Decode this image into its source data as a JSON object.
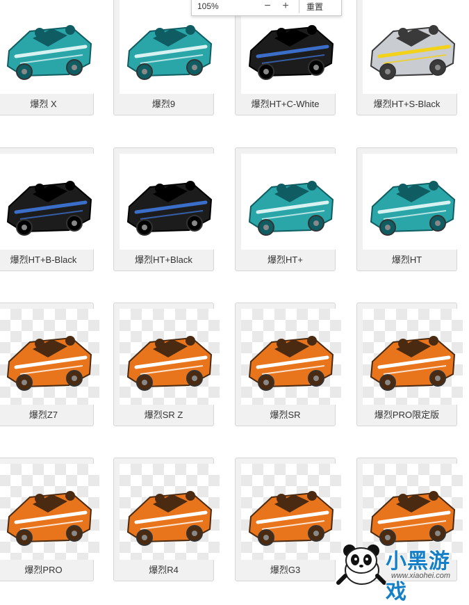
{
  "zoom": {
    "percent": "105%",
    "minus": "−",
    "plus": "+",
    "reset": "重置"
  },
  "cards": [
    {
      "label": "爆烈 X",
      "style": "teal",
      "bg": "plain"
    },
    {
      "label": "爆烈9",
      "style": "teal",
      "bg": "plain"
    },
    {
      "label": "爆烈HT+C-White",
      "style": "black",
      "bg": "plain"
    },
    {
      "label": "爆烈HT+S-Black",
      "style": "silver",
      "bg": "plain"
    },
    {
      "label": "爆烈HT+B-Black",
      "style": "black",
      "bg": "plain"
    },
    {
      "label": "爆烈HT+Black",
      "style": "black",
      "bg": "plain"
    },
    {
      "label": "爆烈HT+",
      "style": "teal",
      "bg": "plain"
    },
    {
      "label": "爆烈HT",
      "style": "teal",
      "bg": "plain"
    },
    {
      "label": "爆烈Z7",
      "style": "orange",
      "bg": "checker"
    },
    {
      "label": "爆烈SR Z",
      "style": "orange",
      "bg": "checker"
    },
    {
      "label": "爆烈SR",
      "style": "orange",
      "bg": "checker"
    },
    {
      "label": "爆烈PRO限定版",
      "style": "orange",
      "bg": "checker"
    },
    {
      "label": "爆烈PRO",
      "style": "orange",
      "bg": "checker"
    },
    {
      "label": "爆烈R4",
      "style": "orange",
      "bg": "checker"
    },
    {
      "label": "爆烈G3",
      "style": "orange",
      "bg": "checker"
    },
    {
      "label": "",
      "style": "orange",
      "bg": "checker"
    }
  ],
  "palette": {
    "teal": {
      "body": "#2aa6a8",
      "dark": "#0f5d62",
      "accent": "#d8f2f2"
    },
    "black": {
      "body": "#1c1c1c",
      "dark": "#000000",
      "accent": "#3b6ec8"
    },
    "silver": {
      "body": "#c9ccd0",
      "dark": "#3a3a3a",
      "accent": "#f3d21a"
    },
    "orange": {
      "body": "#e8741c",
      "dark": "#4a2a10",
      "accent": "#ffffff"
    }
  },
  "watermark": {
    "brand": "小黑游戏",
    "url": "www.xiaohei.com"
  }
}
